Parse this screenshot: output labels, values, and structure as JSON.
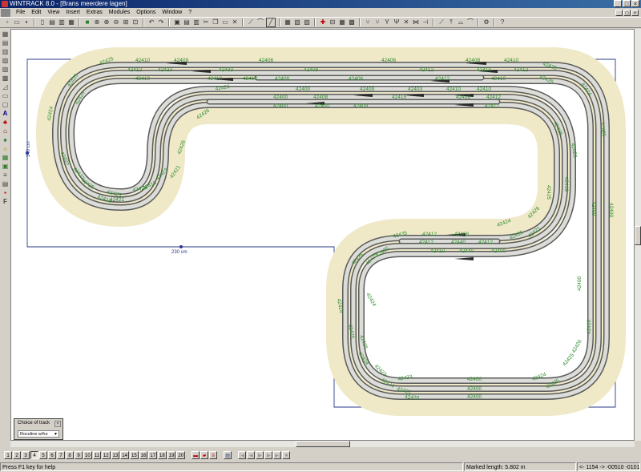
{
  "window": {
    "title": "WINTRACK 8.0 - [Brans meerdere lagen]",
    "controls": [
      "_",
      "□",
      "×"
    ]
  },
  "menu": [
    "File",
    "Edit",
    "View",
    "Insert",
    "Extras",
    "Modules",
    "Options",
    "Window",
    "?"
  ],
  "toolbar_icons": [
    "new-icon",
    "open-icon",
    "save-icon",
    "sep",
    "print-preview-icon",
    "print-icon",
    "page-setup-icon",
    "sep",
    "layers-icon",
    "zoom-fit-icon",
    "zoom-in-icon",
    "zoom-out-icon",
    "zoom-window-icon",
    "sep",
    "undo-icon",
    "redo-icon",
    "sep",
    "cut-icon",
    "copy-icon",
    "paste-icon",
    "delete-icon",
    "sep",
    "track-tool-icon",
    "curve-tool-icon",
    "switch-tool-icon",
    "align-icon",
    "sep",
    "measure-icon",
    "sep",
    "help-icon"
  ],
  "canvas": {
    "dimensions": {
      "top": "440 cm",
      "left": "140 cm",
      "bottom": "230 cm",
      "right": "280 cm"
    },
    "track_labels": {
      "top_row": [
        "42410",
        "42409",
        "42406",
        "42406",
        "42408",
        "42410"
      ],
      "top_inner": [
        "42412",
        "42423",
        "42433",
        "42408",
        "42412",
        "42410",
        "42412"
      ],
      "top_third": [
        "42410",
        "42410",
        "42410",
        "42408",
        "42406",
        "42412",
        "42410"
      ],
      "middle_row": [
        "42400",
        "42409",
        "42403",
        "42410",
        "42410"
      ],
      "middle_row2": [
        "42400",
        "42408",
        "42415",
        "42416",
        "42412"
      ],
      "middle_row3": [
        "42400",
        "42400",
        "42409",
        "42412"
      ],
      "left_curve": [
        "42425",
        "42425",
        "42424",
        "42424",
        "42425",
        "42425",
        "42425",
        "42423",
        "42421",
        "42423",
        "42426",
        "42426"
      ],
      "inner_left": [
        "42426",
        "42421",
        "42423",
        "42416",
        "42413"
      ],
      "right_curve": [
        "42426",
        "42425",
        "42424",
        "42425",
        "42425",
        "42423",
        "42418",
        "42425",
        "42424",
        "42426",
        "42425"
      ],
      "right_straight": [
        "42400",
        "42400",
        "42400",
        "42410"
      ],
      "center_S": [
        "42435",
        "42412",
        "42408",
        "42412",
        "42440",
        "42412",
        "42410",
        "42440",
        "42400",
        "42421"
      ],
      "lower_left": [
        "42426",
        "42425",
        "42424",
        "42425",
        "42425",
        "42424",
        "42423",
        "42424",
        "42423",
        "42421",
        "42420",
        "42424",
        "42425"
      ],
      "bottom": [
        "42400",
        "42400",
        "42400"
      ],
      "bottom_right": [
        "42424",
        "42425",
        "42426",
        "42425"
      ]
    }
  },
  "choice_panel": {
    "title": "Choice of track",
    "selected": "Rocoline w/ho"
  },
  "layer_buttons": [
    "1",
    "2",
    "3",
    "4",
    "5",
    "6",
    "7",
    "8",
    "9",
    "10",
    "11",
    "12",
    "13",
    "14",
    "15",
    "16",
    "17",
    "18",
    "19",
    "20"
  ],
  "status": {
    "help": "Press F1 key for help",
    "marked_length": "Marked length:  5.802 m",
    "coords": "<- 1154  ->  -00510   -01012"
  }
}
